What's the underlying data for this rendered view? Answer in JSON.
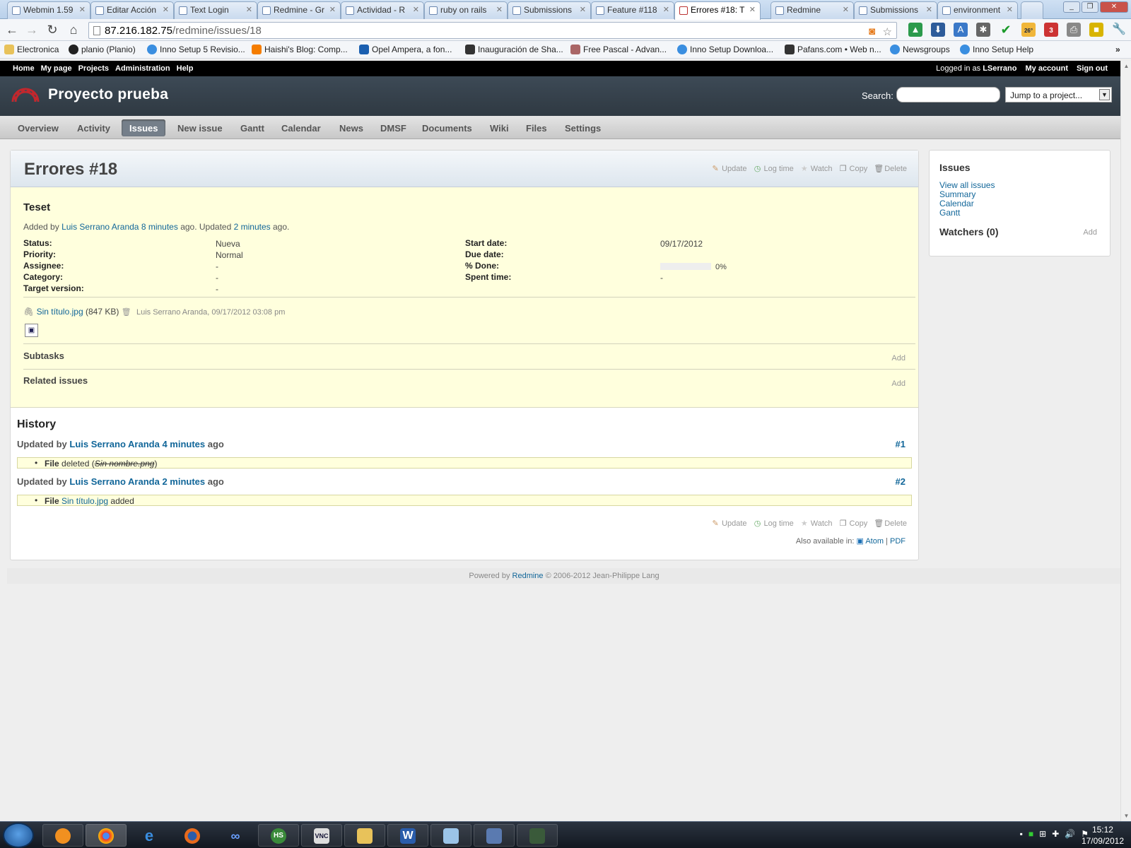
{
  "browser": {
    "tabs": [
      {
        "label": "Webmin 1.59",
        "active": false
      },
      {
        "label": "Editar Acción",
        "active": false
      },
      {
        "label": "Text Login",
        "active": false
      },
      {
        "label": "Redmine - Gr",
        "active": false
      },
      {
        "label": "Actividad - R",
        "active": false
      },
      {
        "label": "ruby on rails",
        "active": false
      },
      {
        "label": "Submissions",
        "active": false
      },
      {
        "label": "Feature #118",
        "active": false
      },
      {
        "label": "Errores #18: T",
        "active": true
      },
      {
        "label": "Redmine",
        "active": false
      },
      {
        "label": "Submissions",
        "active": false
      },
      {
        "label": "environment",
        "active": false
      }
    ],
    "url_host": "87.216.182.75",
    "url_path": "/redmine/issues/18",
    "bookmarks": [
      {
        "label": "Electronica",
        "icon": "folder-icon"
      },
      {
        "label": "planio (Planio)",
        "icon": "github-icon"
      },
      {
        "label": "Inno Setup 5 Revisio...",
        "icon": "ie-icon"
      },
      {
        "label": "Haishi's Blog: Comp...",
        "icon": "blogger-icon"
      },
      {
        "label": "Opel Ampera, a fon...",
        "icon": "opel-icon"
      },
      {
        "label": "Inauguración de Sha...",
        "icon": "page-icon"
      },
      {
        "label": "Free Pascal - Advan...",
        "icon": "fpc-icon"
      },
      {
        "label": "Inno Setup Downloa...",
        "icon": "ie-icon"
      },
      {
        "label": "Pafans.com • Web n...",
        "icon": "page-icon"
      },
      {
        "label": "Newsgroups",
        "icon": "ie-icon"
      },
      {
        "label": "Inno Setup Help",
        "icon": "ie-icon"
      }
    ],
    "extension_badges": {
      "weather": "26°",
      "gmail": "3"
    }
  },
  "redmine": {
    "top_menu": [
      "Home",
      "My page",
      "Projects",
      "Administration",
      "Help"
    ],
    "logged_in_prefix": "Logged in as",
    "logged_in_user": "LSerrano",
    "my_account": "My account",
    "sign_out": "Sign out",
    "project_title": "Proyecto prueba",
    "search_label": "Search:",
    "jump_label": "Jump to a project...",
    "main_menu": [
      {
        "label": "Overview",
        "selected": false
      },
      {
        "label": "Activity",
        "selected": false
      },
      {
        "label": "Issues",
        "selected": true
      },
      {
        "label": "New issue",
        "selected": false
      },
      {
        "label": "Gantt",
        "selected": false
      },
      {
        "label": "Calendar",
        "selected": false
      },
      {
        "label": "News",
        "selected": false
      },
      {
        "label": "DMSF",
        "selected": false
      },
      {
        "label": "Documents",
        "selected": false
      },
      {
        "label": "Wiki",
        "selected": false
      },
      {
        "label": "Files",
        "selected": false
      },
      {
        "label": "Settings",
        "selected": false
      }
    ]
  },
  "issue": {
    "title": "Errores #18",
    "actions": [
      "Update",
      "Log time",
      "Watch",
      "Copy",
      "Delete"
    ],
    "subject": "Teset",
    "added_by_prefix": "Added by",
    "author": "Luis Serrano Aranda",
    "created_ago": "8 minutes",
    "ago_updated": "ago. Updated",
    "updated_ago": "2 minutes",
    "ago_end": "ago.",
    "left_attributes": [
      {
        "label": "Status:",
        "value": "Nueva"
      },
      {
        "label": "Priority:",
        "value": "Normal"
      },
      {
        "label": "Assignee:",
        "value": "-"
      },
      {
        "label": "Category:",
        "value": "-"
      },
      {
        "label": "Target version:",
        "value": "-"
      }
    ],
    "right_attributes": [
      {
        "label": "Start date:",
        "value": "09/17/2012"
      },
      {
        "label": "Due date:",
        "value": ""
      },
      {
        "label": "% Done:",
        "value": "0%"
      },
      {
        "label": "Spent time:",
        "value": "-"
      }
    ],
    "done_ratio": 0,
    "attachment": {
      "filename": "Sin título.jpg",
      "size": "(847 KB)",
      "meta": "Luis Serrano Aranda, 09/17/2012 03:08 pm"
    },
    "subtasks_label": "Subtasks",
    "related_label": "Related issues",
    "add_label": "Add"
  },
  "history": {
    "title": "History",
    "journals": [
      {
        "prefix": "Updated by",
        "author": "Luis Serrano Aranda",
        "ago": "4 minutes",
        "suffix": "ago",
        "number": "#1",
        "detail_field": "File",
        "detail_verb": "deleted (",
        "detail_value": "Sin nombre.png",
        "detail_end": ")"
      },
      {
        "prefix": "Updated by",
        "author": "Luis Serrano Aranda",
        "ago": "2 minutes",
        "suffix": "ago",
        "number": "#2",
        "detail_field": "File",
        "detail_verb": "",
        "detail_value": "Sin título.jpg",
        "detail_end": "added"
      }
    ]
  },
  "also_available": {
    "label": "Also available in:",
    "atom": "Atom",
    "sep": "|",
    "pdf": "PDF"
  },
  "sidebar": {
    "title": "Issues",
    "links": [
      "View all issues",
      "Summary",
      "Calendar",
      "Gantt"
    ],
    "watchers": "Watchers (0)",
    "watchers_add": "Add"
  },
  "footer": {
    "prefix": "Powered by",
    "link": "Redmine",
    "suffix": "© 2006-2012 Jean-Philippe Lang"
  },
  "taskbar": {
    "time": "15:12",
    "date": "17/09/2012"
  },
  "colors": {
    "link": "#116699",
    "header": "#3d4a56",
    "issue_bg": "#ffffdd"
  }
}
